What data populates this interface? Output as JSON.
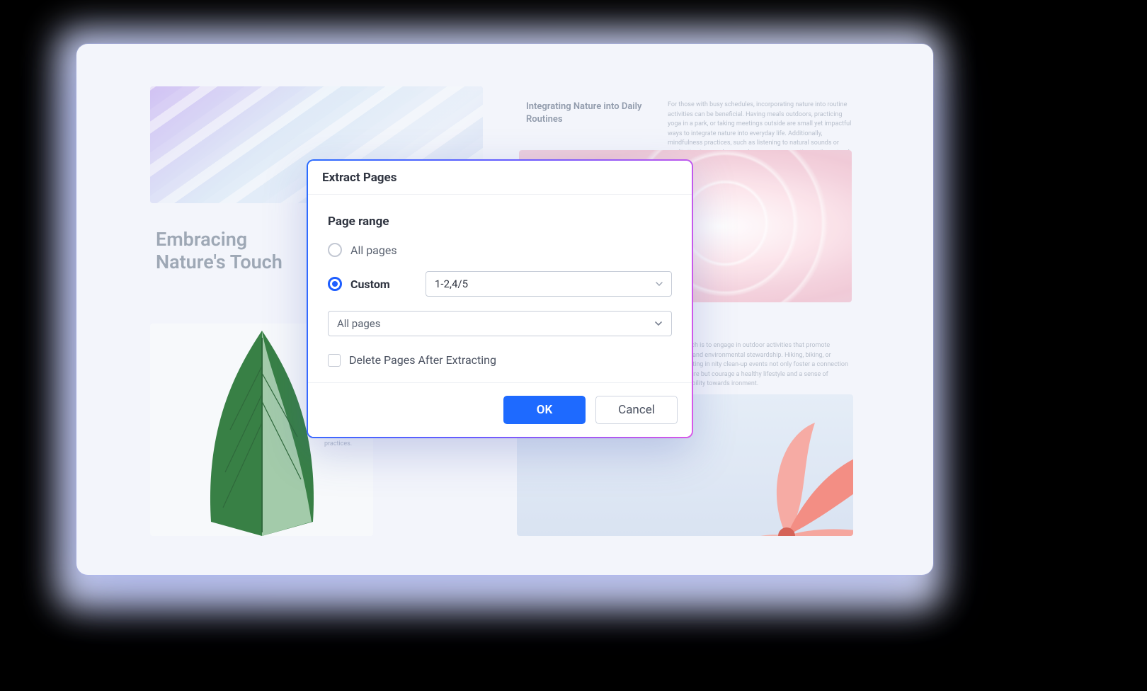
{
  "background": {
    "title_left_line1": "Embracing",
    "title_left_line2": "Nature's Touch",
    "heading_right": "Integrating Nature into Daily Routines",
    "para_right": "For those with busy schedules, incorporating nature into routine activities can be beneficial. Having meals outdoors, practicing yoga in a park, or taking meetings outside are small yet impactful ways to integrate nature into everyday life. Additionally, mindfulness practices, such as listening to natural sounds or meditating in a garden, can deepen our connection to the natural world.",
    "para_right2": "r approach is to engage in outdoor activities that promote physical and environmental stewardship. Hiking, biking, or participating in nity clean-up events not only foster a connection with nature but courage a healthy lifestyle and a sense of responsibility towards ironment.",
    "practices_label": "practices."
  },
  "dialog": {
    "title": "Extract Pages",
    "section_label": "Page range",
    "radio_all": "All pages",
    "radio_custom": "Custom",
    "custom_value": "1-2,4/5",
    "dropdown_value": "All pages",
    "checkbox_label": "Delete Pages After Extracting",
    "ok_label": "OK",
    "cancel_label": "Cancel",
    "selected_radio": "custom",
    "checkbox_checked": false
  }
}
